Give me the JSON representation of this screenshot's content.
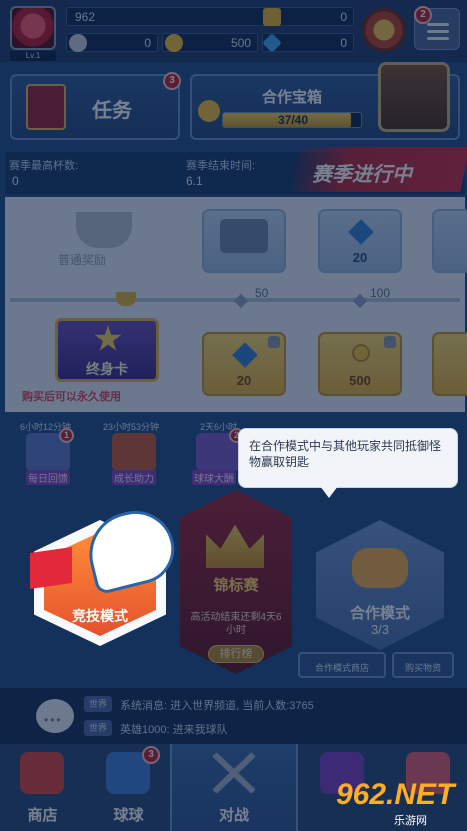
{
  "player": {
    "level": "Lv.1"
  },
  "resources": {
    "trophies": "962",
    "trophy_extra": "0",
    "gold_alt": "0",
    "gold": "500",
    "gems": "0"
  },
  "menu_badge": "2",
  "task": {
    "label": "任务",
    "badge": "3"
  },
  "chest": {
    "title": "合作宝箱",
    "progress": "37/40",
    "fraction": 0.925
  },
  "season": {
    "trophies_label": "赛季最高杯数:",
    "trophies_value": "0",
    "end_label": "赛季结束时间:",
    "end_value": "6.1",
    "banner": "赛季进行中"
  },
  "pass": {
    "normal_label": "普通奖励",
    "milestones": [
      "50",
      "100"
    ],
    "free_rewards": [
      "",
      "20",
      ""
    ],
    "premium_rewards": [
      "20",
      "500",
      ""
    ],
    "lifetime_label": "终身卡",
    "lifetime_note": "购买后可以永久使用"
  },
  "events": [
    {
      "time": "6小时12分钟",
      "name": "每日回馈",
      "badge": "1"
    },
    {
      "time": "23小时53分钟",
      "name": "成长助力",
      "badge": ""
    },
    {
      "time": "2天6小时",
      "name": "球球大酬",
      "badge": "2"
    }
  ],
  "tooltip": "在合作模式中与其他玩家共同抵御怪物赢取钥匙",
  "modes": {
    "competitive": "竞技模式",
    "tournament": {
      "title": "锦标赛",
      "desc": "高活动结束还剩4天6小时",
      "rank_button": "排行榜"
    },
    "coop": {
      "title": "合作模式",
      "count": "3/3",
      "shop": "合作模式商店",
      "buy": "购买物资"
    }
  },
  "chat": [
    {
      "tag": "世界",
      "text": "系统消息: 进入世界频道, 当前人数:3765"
    },
    {
      "tag": "世界",
      "text": "英雄1000: 进来我球队"
    }
  ],
  "nav": [
    {
      "label": "商店",
      "badge": ""
    },
    {
      "label": "球球",
      "badge": "3"
    },
    {
      "label": "对战",
      "badge": ""
    },
    {
      "label": "",
      "badge": ""
    },
    {
      "label": "",
      "badge": ""
    }
  ],
  "watermark": {
    "main": "962.NET",
    "sub": "乐游网"
  },
  "colors": {
    "accent": "#ffae22",
    "banner": "#c92c45",
    "panel": "#24487c"
  }
}
